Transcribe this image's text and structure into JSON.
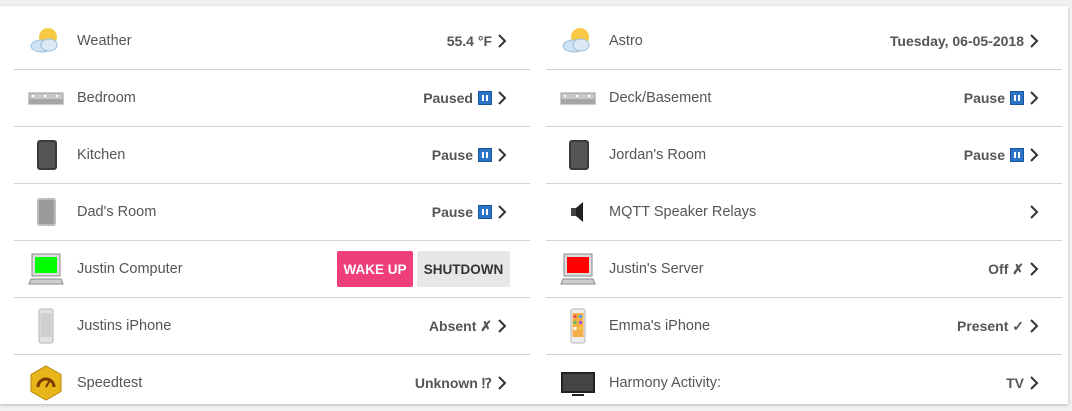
{
  "left": [
    {
      "label": "Weather",
      "state": "55.4 °F",
      "icon": "weather-icon"
    },
    {
      "label": "Bedroom",
      "state": "Paused",
      "icon": "playbar-speaker-icon",
      "pause": true
    },
    {
      "label": "Kitchen",
      "state": "Pause",
      "icon": "play1-speaker-icon",
      "pause": true
    },
    {
      "label": "Dad's Room",
      "state": "Pause",
      "icon": "play1-white-speaker-icon",
      "pause": true
    },
    {
      "label": "Justin Computer",
      "icon": "computer-icon",
      "buttons": {
        "wake": "WAKE UP",
        "shutdown": "SHUTDOWN"
      }
    },
    {
      "label": "Justins iPhone",
      "state": "Absent ✗",
      "icon": "iphone-icon"
    },
    {
      "label": "Speedtest",
      "state": "Unknown ⁉",
      "icon": "speedtest-icon"
    }
  ],
  "right": [
    {
      "label": "Astro",
      "state": "Tuesday, 06-05-2018",
      "icon": "weather-icon"
    },
    {
      "label": "Deck/Basement",
      "state": "Pause",
      "icon": "playbar-speaker-icon",
      "pause": true
    },
    {
      "label": "Jordan's Room",
      "state": "Pause",
      "icon": "play1-speaker-icon",
      "pause": true
    },
    {
      "label": "MQTT Speaker Relays",
      "state": "",
      "icon": "speaker-relay-icon"
    },
    {
      "label": "Justin's Server",
      "state": "Off ✗",
      "icon": "server-icon"
    },
    {
      "label": "Emma's iPhone",
      "state": "Present ✓",
      "icon": "iphone-color-icon"
    },
    {
      "label": "Harmony Activity:",
      "state": "TV",
      "icon": "tv-icon"
    }
  ],
  "colors": {
    "accent": "#ee3f7c",
    "pause": "#2b74c8",
    "computer_screen": "#00ff00",
    "server_screen": "#ff0000"
  }
}
